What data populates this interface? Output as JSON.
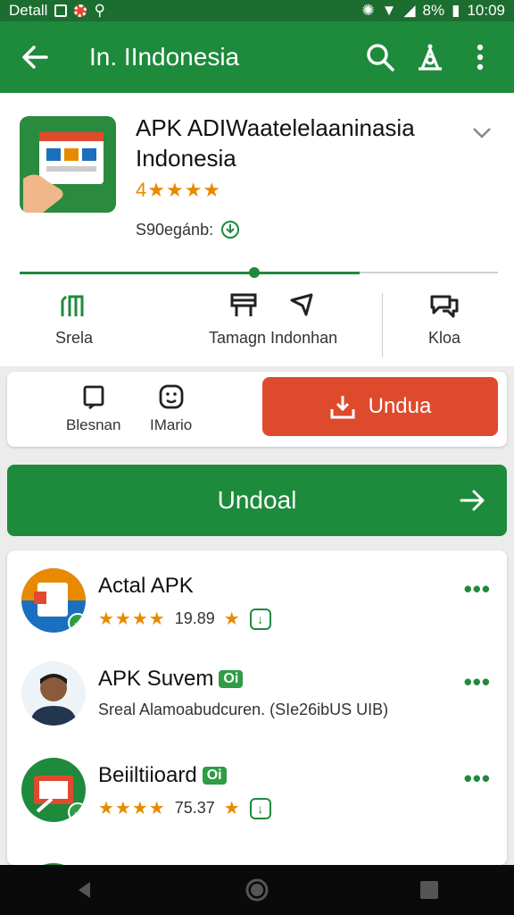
{
  "status_bar": {
    "carrier": "Detall",
    "battery": "8%",
    "time": "10:09"
  },
  "app_bar": {
    "title": "In. IIndonesia"
  },
  "app": {
    "name": "APK ADIWaatelelaaninasia Indonesia",
    "rating_text": "4",
    "rating_stars": "★★★★",
    "size_label": "S90egánb:"
  },
  "progress": {
    "fraction": 0.71,
    "knob_fraction": 0.49
  },
  "stats": [
    {
      "label": "Srela"
    },
    {
      "label": "Tamagn Indonhan"
    },
    {
      "label": "Kloa"
    }
  ],
  "actions": {
    "bookmark_label": "Blesnan",
    "profile_label": "IMario",
    "download_label": "Undua"
  },
  "primary_button": {
    "label": "Undoal"
  },
  "list": [
    {
      "name": "Actal APK",
      "badge": "",
      "stars": "★★★★",
      "meta": "19.89",
      "sub": "",
      "avatar_color": "#1a6fbf"
    },
    {
      "name": "APK Suvem",
      "badge": "Oi",
      "stars": "",
      "meta": "",
      "sub": "Sreal Alamoabudcuren. (SIe26ibUS UIB)",
      "avatar_color": "#ffffff"
    },
    {
      "name": "Beiiltiioard",
      "badge": "Oi",
      "stars": "★★★★",
      "meta": "75.37",
      "sub": "",
      "avatar_color": "#1e8a3c"
    }
  ],
  "colors": {
    "primary": "#1e8a3c",
    "accent": "#dd4a2c",
    "star": "#e88a00"
  }
}
